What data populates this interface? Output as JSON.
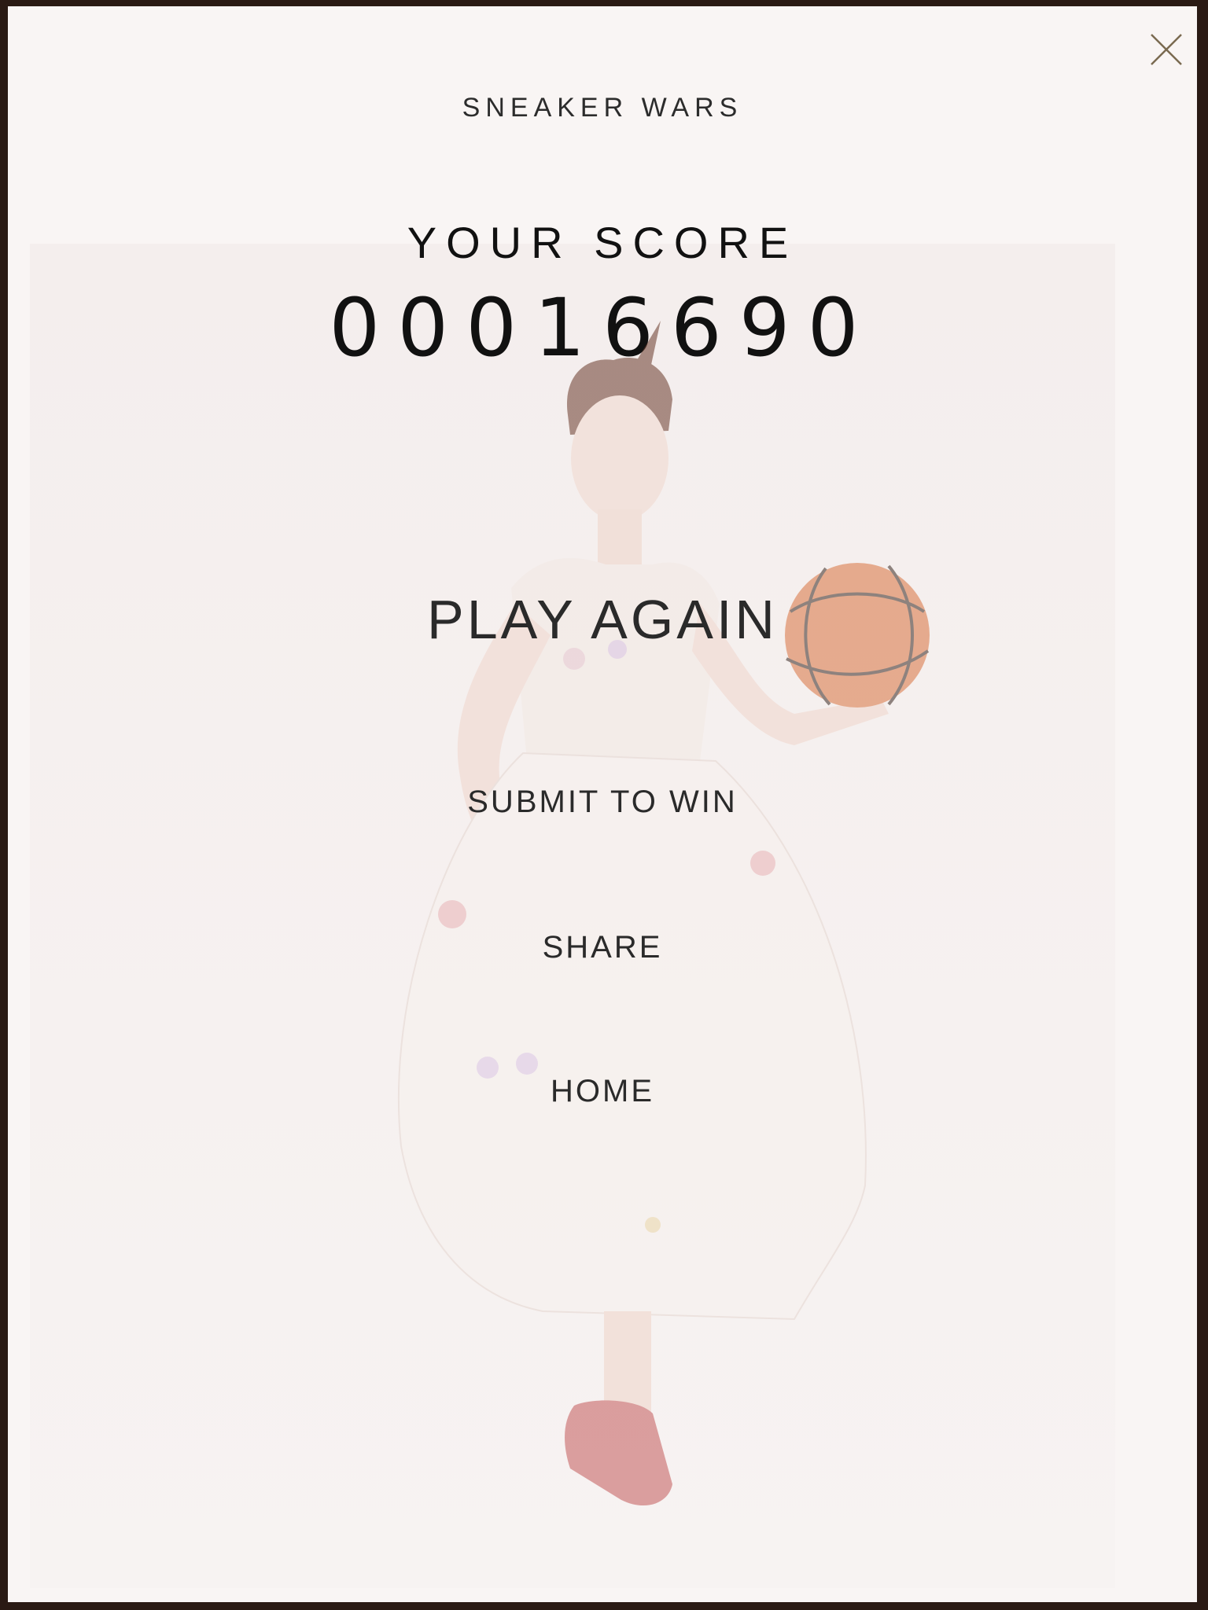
{
  "game": {
    "title": "SNEAKER WARS"
  },
  "results": {
    "score_label": "YOUR SCORE",
    "score_value": "00016690"
  },
  "menu": {
    "play_again": "PLAY AGAIN",
    "submit": "SUBMIT TO WIN",
    "share": "SHARE",
    "home": "HOME"
  },
  "icons": {
    "close": "close-icon",
    "ball": "basketball-icon"
  },
  "colors": {
    "frame": "#2a1a14",
    "background": "#f9f5f4",
    "text": "#111111",
    "close": "#7a6a50",
    "ball": "#d9733f",
    "sneaker": "#c4595a"
  }
}
